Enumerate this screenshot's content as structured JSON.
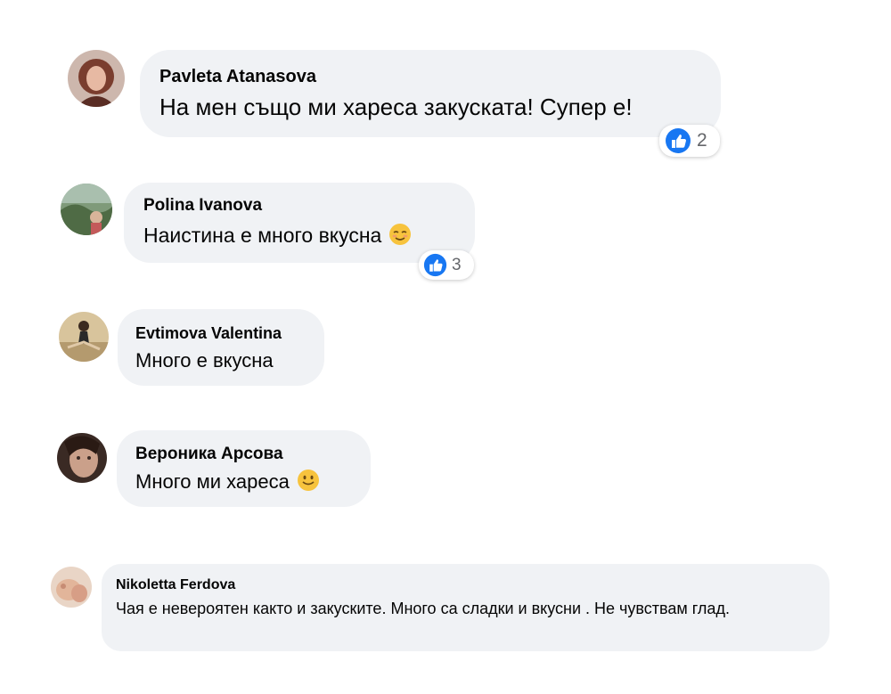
{
  "colors": {
    "bubble_bg": "#f0f2f5",
    "like_blue": "#1877f2",
    "count_gray": "#65676b",
    "text": "#050505"
  },
  "comments": [
    {
      "author": "Pavleta Atanasova",
      "text": "На мен също ми хареса закуската! Супер е!",
      "avatar_icon": "user-avatar-photo",
      "reaction": {
        "icon": "like-icon",
        "count": "2"
      }
    },
    {
      "author": "Polina Ivanova",
      "text": "Наистина е много вкусна",
      "emoji": "smiling-face-emoji",
      "avatar_icon": "user-avatar-photo",
      "reaction": {
        "icon": "like-icon",
        "count": "3"
      }
    },
    {
      "author": "Evtimova Valentina",
      "text": "Много е вкусна",
      "avatar_icon": "user-avatar-photo"
    },
    {
      "author": "Вероника Арсова",
      "text": "Много ми хареса",
      "emoji": "slightly-smiling-face-emoji",
      "avatar_icon": "user-avatar-photo"
    },
    {
      "author": "Nikoletta Ferdova",
      "text": "Чая е невероятен както и закуските. Много са сладки и вкусни . Не чувствам глад.",
      "avatar_icon": "user-avatar-photo"
    }
  ]
}
